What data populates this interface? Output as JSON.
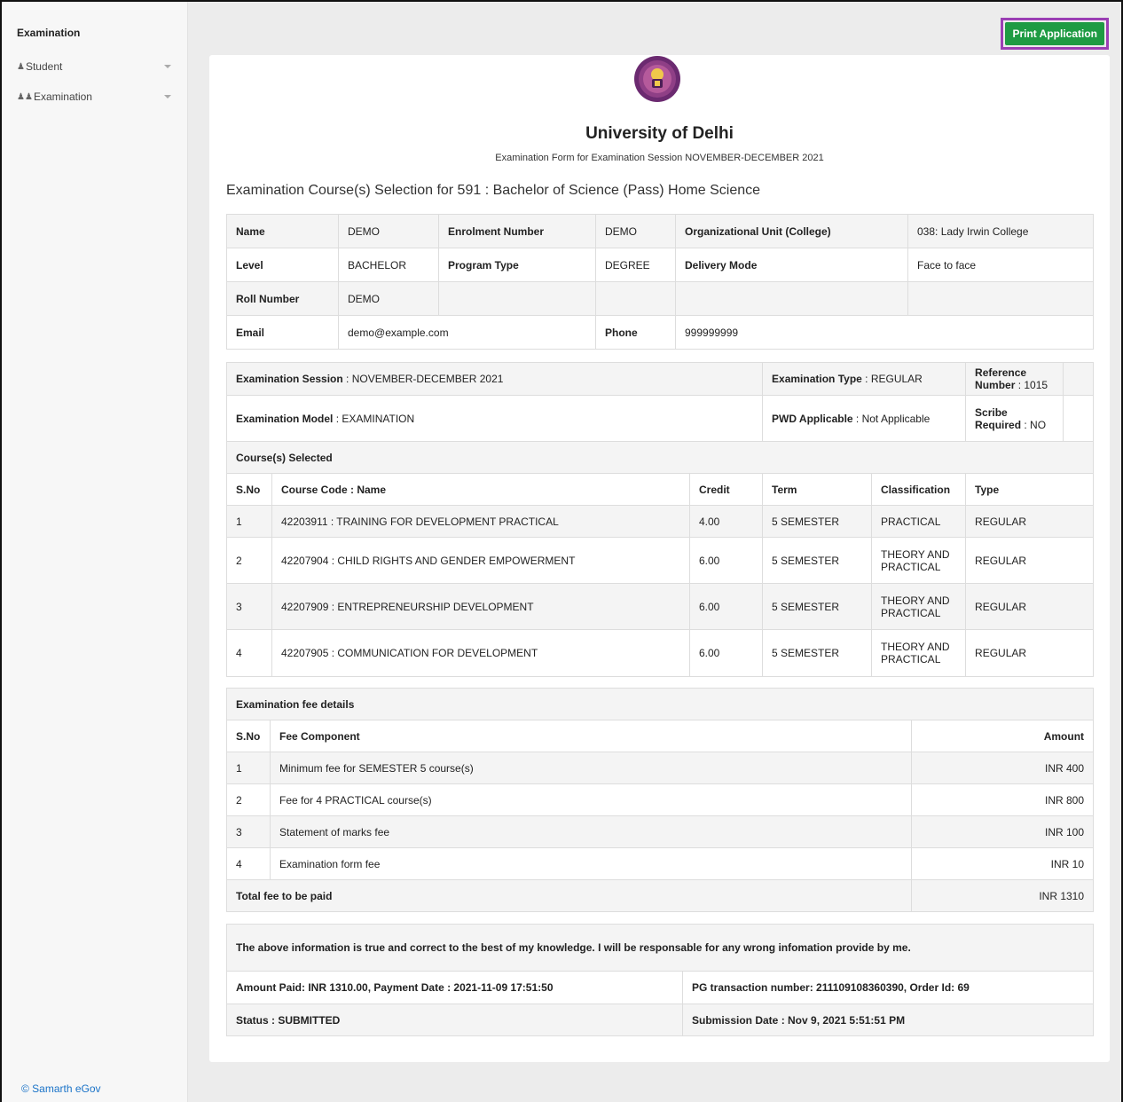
{
  "sidebar": {
    "brand": "Examination",
    "items": [
      {
        "label": "Student",
        "icon": "user-icon"
      },
      {
        "label": "Examination",
        "icon": "users-icon"
      }
    ]
  },
  "toolbar": {
    "print_label": "Print Application"
  },
  "header": {
    "university": "University of Delhi",
    "form_title": "Examination Form for Examination Session NOVEMBER-DECEMBER 2021",
    "selection_title": "Examination Course(s) Selection for 591 : Bachelor of Science (Pass) Home Science"
  },
  "student": {
    "name_label": "Name",
    "name": "DEMO",
    "enrolment_label": "Enrolment Number",
    "enrolment": "DEMO",
    "org_label": "Organizational Unit (College)",
    "org": "038: Lady Irwin College",
    "level_label": "Level",
    "level": "BACHELOR",
    "program_type_label": "Program Type",
    "program_type": "DEGREE",
    "delivery_label": "Delivery Mode",
    "delivery": "Face to face",
    "roll_label": "Roll Number",
    "roll": "DEMO",
    "email_label": "Email",
    "email": "demo@example.com",
    "phone_label": "Phone",
    "phone": "999999999"
  },
  "exam": {
    "session_label": "Examination Session",
    "session": " : NOVEMBER-DECEMBER 2021",
    "type_label": "Examination Type",
    "type": " : REGULAR",
    "ref_label": "Reference Number",
    "ref": " : 1015",
    "model_label": "Examination Model",
    "model": " : EXAMINATION",
    "pwd_label": "PWD Applicable",
    "pwd": " : Not Applicable",
    "scribe_label": "Scribe Required",
    "scribe": " : NO",
    "courses_heading": "Course(s) Selected",
    "course_headers": [
      "S.No",
      "Course Code : Name",
      "Credit",
      "Term",
      "Classification",
      "Type"
    ],
    "courses": [
      [
        "1",
        "42203911 : TRAINING FOR DEVELOPMENT PRACTICAL",
        "4.00",
        "5 SEMESTER",
        "PRACTICAL",
        "REGULAR"
      ],
      [
        "2",
        "42207904 : CHILD RIGHTS AND GENDER EMPOWERMENT",
        "6.00",
        "5 SEMESTER",
        "THEORY AND PRACTICAL",
        "REGULAR"
      ],
      [
        "3",
        "42207909 : ENTREPRENEURSHIP DEVELOPMENT",
        "6.00",
        "5 SEMESTER",
        "THEORY AND PRACTICAL",
        "REGULAR"
      ],
      [
        "4",
        "42207905 : COMMUNICATION FOR DEVELOPMENT",
        "6.00",
        "5 SEMESTER",
        "THEORY AND PRACTICAL",
        "REGULAR"
      ]
    ]
  },
  "fees": {
    "heading": "Examination fee details",
    "headers": [
      "S.No",
      "Fee Component",
      "Amount"
    ],
    "rows": [
      [
        "1",
        "Minimum fee for SEMESTER 5 course(s)",
        "INR 400"
      ],
      [
        "2",
        "Fee for 4 PRACTICAL course(s)",
        "INR 800"
      ],
      [
        "3",
        "Statement of marks fee",
        "INR 100"
      ],
      [
        "4",
        "Examination form fee",
        "INR 10"
      ]
    ],
    "total_label": "Total fee to be paid",
    "total": "INR 1310"
  },
  "declaration": {
    "text": "The above information is true and correct to the best of my knowledge. I will be responsable for any wrong infomation provide by me.",
    "amount_paid": "Amount Paid: INR 1310.00, Payment Date : 2021-11-09 17:51:50",
    "pg_txn": "PG transaction number: 211109108360390, Order Id: 69",
    "status": "Status : SUBMITTED",
    "submission": "Submission Date : Nov 9, 2021 5:51:51 PM"
  },
  "footer": {
    "link": "© Samarth eGov"
  },
  "colors": {
    "accent_green": "#1e9b43",
    "highlight_purple": "#9b3fb4",
    "link_blue": "#1a73c8"
  }
}
